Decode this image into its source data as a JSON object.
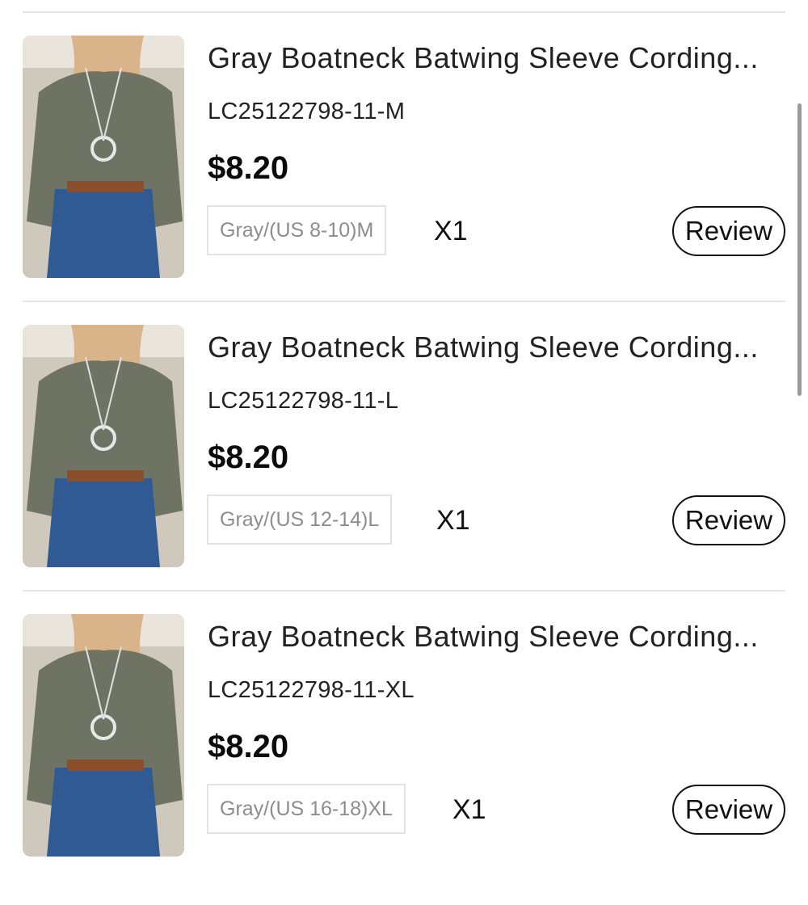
{
  "orders": {
    "items": [
      {
        "title": "Gray Boatneck Batwing Sleeve Cording...",
        "sku": "LC25122798-11-M",
        "price": "$8.20",
        "variant": "Gray/(US 8-10)M",
        "quantity": "X1",
        "review_label": "Review",
        "image_icon": "product-photo"
      },
      {
        "title": "Gray Boatneck Batwing Sleeve Cording...",
        "sku": "LC25122798-11-L",
        "price": "$8.20",
        "variant": "Gray/(US 12-14)L",
        "quantity": "X1",
        "review_label": "Review",
        "image_icon": "product-photo"
      },
      {
        "title": "Gray Boatneck Batwing Sleeve Cording...",
        "sku": "LC25122798-11-XL",
        "price": "$8.20",
        "variant": "Gray/(US 16-18)XL",
        "quantity": "X1",
        "review_label": "Review",
        "image_icon": "product-photo"
      }
    ]
  },
  "colors": {
    "divider": "#e4e4e4",
    "price": "#0b0b0b",
    "variant_text": "#8d8d8d",
    "review_border": "#111111"
  }
}
